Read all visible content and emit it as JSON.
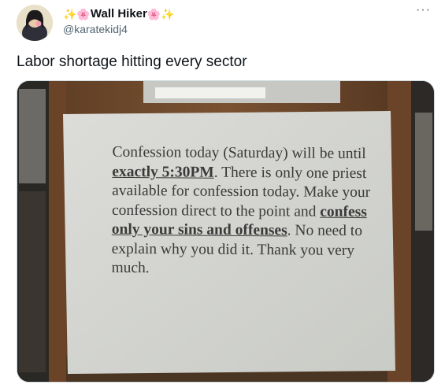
{
  "tweet": {
    "author": {
      "emoji_left": "✨🌸",
      "display_name": "Wall Hiker",
      "emoji_right": "🌸✨",
      "handle": "@karatekidj4"
    },
    "more_label": "···",
    "text": "Labor shortage hitting every sector"
  },
  "sign": {
    "p1": "Confession today (Saturday) will be until ",
    "u1": "exactly 5:30PM",
    "p2": ". There is only one priest available for confession today. Make your confession direct to the point and ",
    "u2": "confess only your sins and offenses",
    "p3": ". No need to explain why you did it. Thank you very much."
  }
}
